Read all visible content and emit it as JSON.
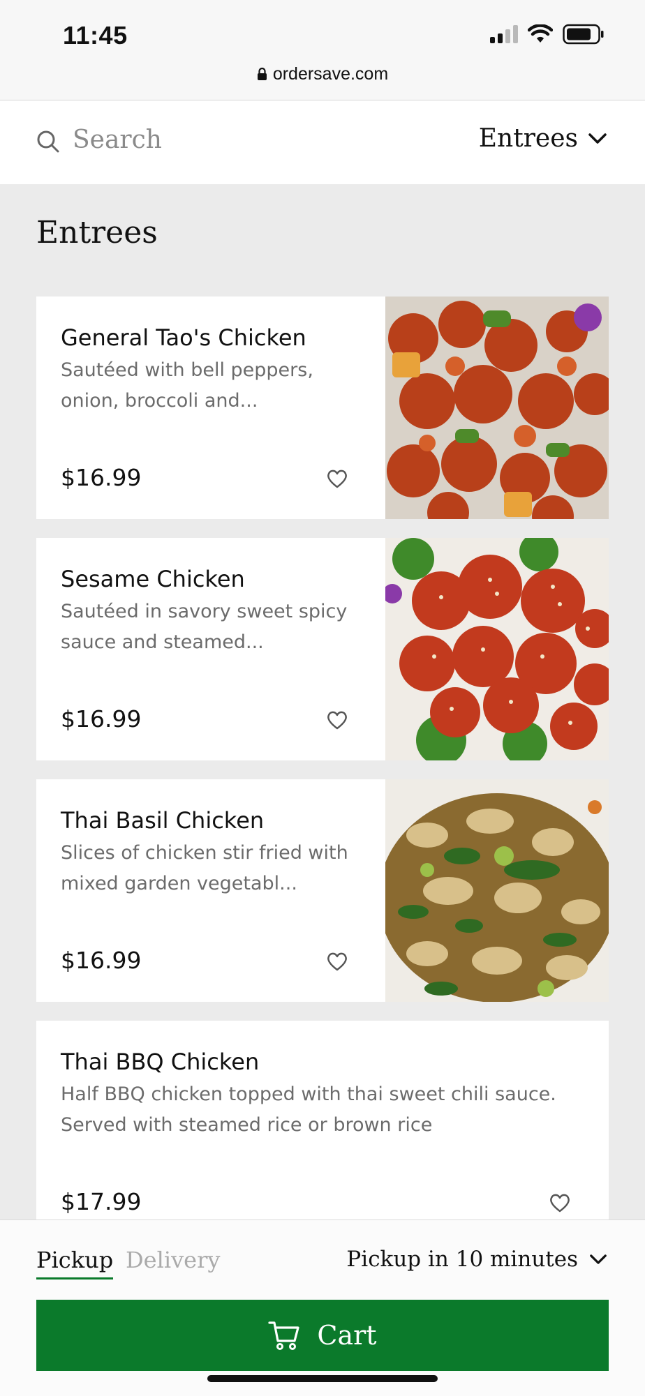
{
  "status_bar": {
    "time": "11:45",
    "url": "ordersave.com"
  },
  "search": {
    "placeholder": "Search",
    "category": "Entrees"
  },
  "section": {
    "title": "Entrees"
  },
  "items": [
    {
      "name": "General Tao's Chicken",
      "description": "Sautéed with bell peppers, onion, broccoli and...",
      "price": "$16.99"
    },
    {
      "name": "Sesame Chicken",
      "description": "Sautéed in savory sweet spicy sauce and steamed...",
      "price": "$16.99"
    },
    {
      "name": "Thai Basil Chicken",
      "description": "Slices of chicken stir fried with mixed garden vegetabl...",
      "price": "$16.99"
    },
    {
      "name": "Thai BBQ Chicken",
      "description": "Half BBQ chicken topped with thai sweet chili sauce. Served with steamed rice or brown rice",
      "price": "$17.99"
    }
  ],
  "order_mode": {
    "pickup_label": "Pickup",
    "delivery_label": "Delivery",
    "pickup_time": "Pickup in 10 minutes"
  },
  "cart": {
    "label": "Cart"
  },
  "colors": {
    "accent": "#0b7a2b",
    "background": "#ebebeb",
    "muted_text": "#6b6b6b"
  }
}
